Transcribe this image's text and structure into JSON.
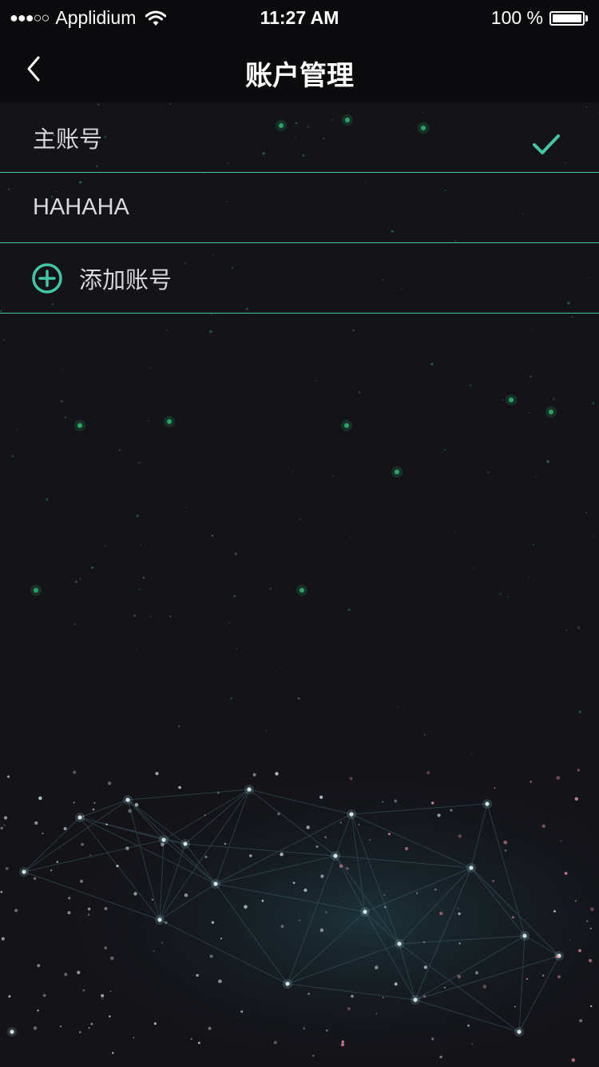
{
  "status_bar": {
    "signal": "●●●○○",
    "carrier": "Applidium",
    "wifi_icon": "wifi-icon",
    "time": "11:27 AM",
    "battery_text": "100 %",
    "battery_level": 1.0
  },
  "nav": {
    "back_icon": "chevron-left-icon",
    "title": "账户管理"
  },
  "accounts": {
    "main_label": "主账号",
    "main_selected": true,
    "second_label": "HAHAHA",
    "add_label": "添加账号",
    "add_icon": "plus-circle-icon",
    "check_icon": "check-icon"
  },
  "colors": {
    "accent": "#43c7a6",
    "background": "#141318",
    "bar": "#0b0b0d",
    "text": "#d8d8dc"
  }
}
